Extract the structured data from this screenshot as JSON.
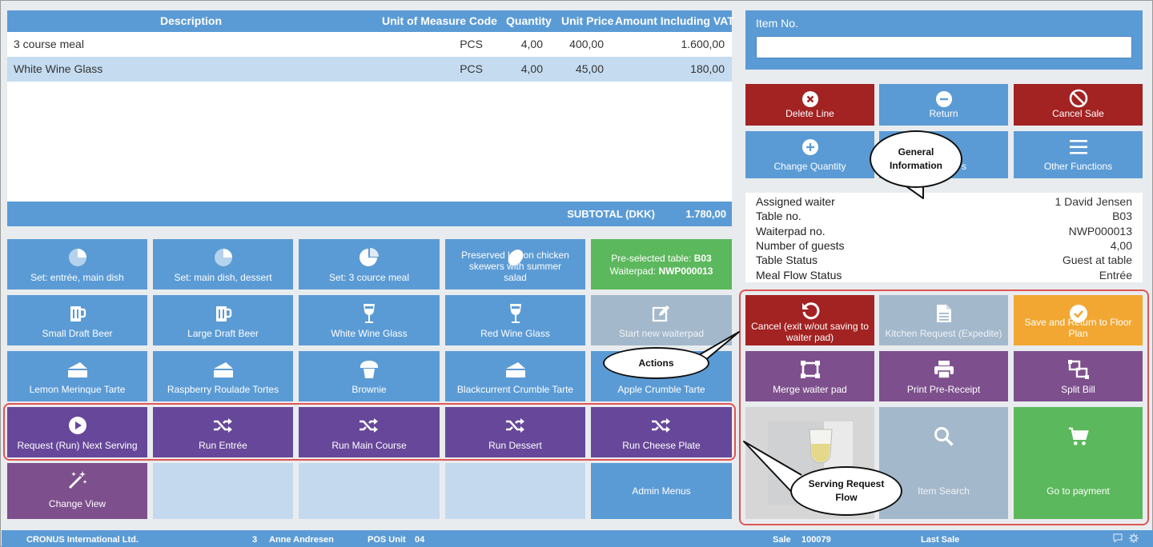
{
  "table": {
    "headers": {
      "description": "Description",
      "uom": "Unit of Measure Code",
      "quantity": "Quantity",
      "unit_price": "Unit Price",
      "amount": "Amount Including VAT"
    },
    "rows": [
      {
        "description": "3 course meal",
        "uom": "PCS",
        "quantity": "4,00",
        "unit_price": "400,00",
        "amount": "1.600,00"
      },
      {
        "description": "White Wine Glass",
        "uom": "PCS",
        "quantity": "4,00",
        "unit_price": "45,00",
        "amount": "180,00"
      }
    ],
    "subtotal_label": "SUBTOTAL (DKK)",
    "subtotal_value": "1.780,00"
  },
  "item_no": {
    "label": "Item No.",
    "value": ""
  },
  "buttons": {
    "delete_line": "Delete Line",
    "return": "Return",
    "cancel_sale": "Cancel Sale",
    "change_quantity": "Change Quantity",
    "discount_partial": "s",
    "other_functions": "Other Functions"
  },
  "info": {
    "assigned_waiter_k": "Assigned waiter",
    "assigned_waiter_v": "1 David Jensen",
    "table_no_k": "Table no.",
    "table_no_v": "B03",
    "waiterpad_k": "Waiterpad no.",
    "waiterpad_v": "NWP000013",
    "guests_k": "Number of guests",
    "guests_v": "4,00",
    "table_status_k": "Table Status",
    "table_status_v": "Guest at table",
    "meal_flow_k": "Meal Flow Status",
    "meal_flow_v": "Entrée"
  },
  "menu": {
    "set_entree_main": "Set: entrée, main dish",
    "set_main_dessert": "Set: main dish, dessert",
    "set_3_course": "Set: 3 cource meal",
    "chicken": "Preserved lemon chicken skewers with summer salad",
    "preselected_label": "Pre-selected table: ",
    "preselected_table": "B03",
    "waiterpad_label": "Waiterpad: ",
    "waiterpad_value": "NWP000013",
    "small_beer": "Small Draft Beer",
    "large_beer": "Large Draft Beer",
    "white_wine": "White Wine Glass",
    "red_wine": "Red Wine Glass",
    "start_waiterpad": "Start new waiterpad",
    "lemon_tarte": "Lemon Merinque Tarte",
    "raspberry": "Raspberry Roulade Tortes",
    "brownie": "Brownie",
    "blackcurrant": "Blackcurrent Crumble Tarte",
    "apple": "Apple Crumble Tarte",
    "request_next": "Request (Run) Next Serving",
    "run_entree": "Run Entrée",
    "run_main": "Run Main Course",
    "run_dessert": "Run Dessert",
    "run_cheese": "Run Cheese Plate",
    "change_view": "Change View",
    "admin_menus": "Admin Menus"
  },
  "actions": {
    "cancel_exit": "Cancel (exit w/out saving to waiter pad)",
    "kitchen_request": "Kitchen Request (Expedite)",
    "save_return": "Save and Return to Floor Plan",
    "merge": "Merge waiter pad",
    "print_pre": "Print Pre-Receipt",
    "split_bill": "Split Bill",
    "item_search": "Item Search",
    "go_payment": "Go to payment"
  },
  "callouts": {
    "general": "General Information",
    "actions": "Actions",
    "serving": "Serving Request Flow"
  },
  "status": {
    "company": "CRONUS International Ltd.",
    "user_no": "3",
    "user_name": "Anne Andresen",
    "pos_unit_label": "POS Unit",
    "pos_unit_value": "04",
    "sale_label": "Sale",
    "sale_value": "100079",
    "last_sale": "Last Sale"
  },
  "colors": {
    "blue": "#5b9bd5",
    "red": "#a32222",
    "purple": "#67479a",
    "orange": "#f1a731",
    "green": "#5cb85c",
    "callout_border": "#e05555"
  }
}
